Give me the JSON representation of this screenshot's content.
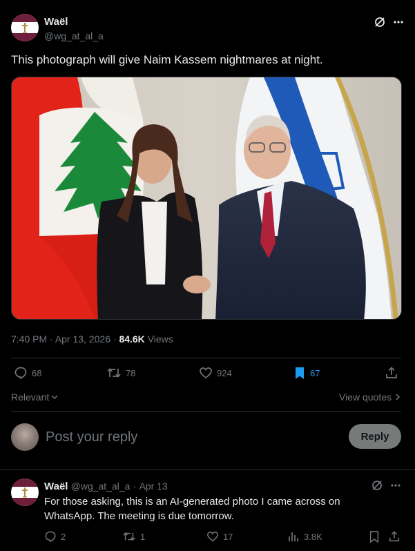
{
  "post": {
    "display_name": "Waël",
    "handle": "@wg_at_al_a",
    "text": "This photograph will give Naim Kassem nightmares at night.",
    "photo_alt": "",
    "time": "7:40 PM",
    "sep1": " · ",
    "date": "Apr 13, 2026",
    "sep2": " · ",
    "views_count": "84.6K",
    "views_label": "Views"
  },
  "actions": {
    "replies": "68",
    "reposts": "78",
    "likes": "924",
    "bookmarks": "67"
  },
  "sort": {
    "relevant_label": "Relevant",
    "view_quotes_label": "View quotes"
  },
  "compose": {
    "placeholder": "Post your reply",
    "button_label": "Reply"
  },
  "reply": {
    "display_name": "Waël",
    "handle": "@wg_at_al_a",
    "dot": "·",
    "date": "Apr 13",
    "text": "For those asking, this is an AI-generated photo I came across on WhatsApp. The meeting is due tomorrow.",
    "replies": "2",
    "reposts": "1",
    "likes": "17",
    "views": "3.8K"
  },
  "colors": {
    "background": "#000000",
    "text_primary": "#e7e9ea",
    "text_secondary": "#71767b",
    "divider": "#2f3336",
    "accent": "#1d9bf0",
    "flag_maroon": "#6e1f3c"
  },
  "icons": [
    "lebanese-flag-avatar",
    "grok-icon",
    "more-icon",
    "reply-icon",
    "repost-icon",
    "like-icon",
    "bookmark-icon",
    "share-icon",
    "chevron-down-icon",
    "chevron-right-icon",
    "views-icon"
  ]
}
